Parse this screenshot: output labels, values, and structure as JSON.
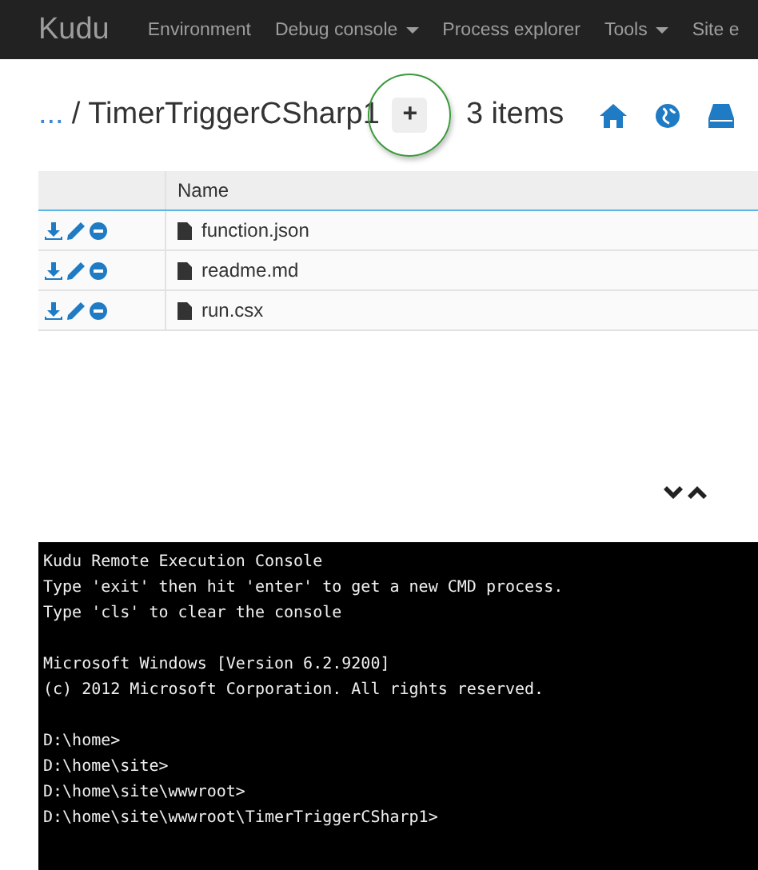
{
  "navbar": {
    "logo": "Kudu",
    "items": [
      {
        "label": "Environment",
        "dropdown": false
      },
      {
        "label": "Debug console",
        "dropdown": true
      },
      {
        "label": "Process explorer",
        "dropdown": false
      },
      {
        "label": "Tools",
        "dropdown": true
      },
      {
        "label": "Site e"
      }
    ]
  },
  "breadcrumb": {
    "ellipsis": "...",
    "separator": "/",
    "folder": "TimerTriggerCSharp1",
    "add_button": "+",
    "count": "3 items"
  },
  "table": {
    "columns": [
      "Name"
    ],
    "rows": [
      {
        "name": "function.json"
      },
      {
        "name": "readme.md"
      },
      {
        "name": "run.csx"
      }
    ]
  },
  "console": {
    "blocks": [
      [
        "Kudu Remote Execution Console",
        "Type 'exit' then hit 'enter' to get a new CMD process.",
        "Type 'cls' to clear the console"
      ],
      [
        "Microsoft Windows [Version 6.2.9200]",
        "(c) 2012 Microsoft Corporation. All rights reserved."
      ],
      [
        "D:\\home>",
        "D:\\home\\site>",
        "D:\\home\\site\\wwwroot>",
        "D:\\home\\site\\wwwroot\\TimerTriggerCSharp1>"
      ]
    ]
  }
}
